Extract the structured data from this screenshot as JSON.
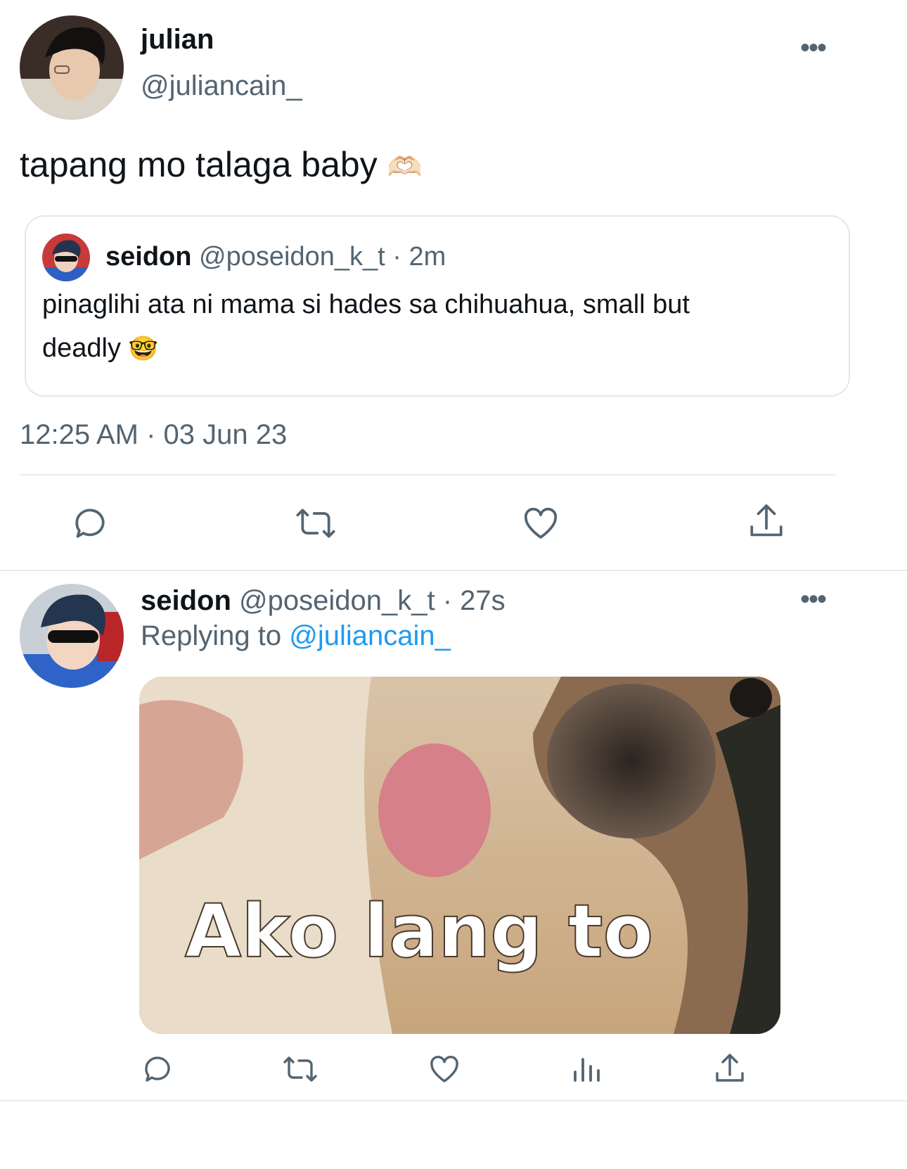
{
  "main_tweet": {
    "author_name": "julian",
    "author_handle": "@juliancain_",
    "text": "tapang mo talaga baby",
    "emoji": "🫶🏻",
    "timestamp": "12:25 AM · 03 Jun 23",
    "quoted": {
      "author_name": "seidon",
      "author_handle": "@poseidon_k_t",
      "age": "· 2m",
      "text_line1": "pinaglihi ata ni mama si hades sa chihuahua, small but",
      "text_line2": "deadly",
      "emoji": "🤓"
    },
    "actions": [
      "reply-icon",
      "retweet-icon",
      "like-icon",
      "share-icon"
    ]
  },
  "reply_tweet": {
    "author_name": "seidon",
    "author_handle": "@poseidon_k_t",
    "age": "· 27s",
    "replying_prefix": "Replying to",
    "replying_handle": "@juliancain_",
    "image_caption": "Ako lang to",
    "actions": [
      "reply-icon",
      "retweet-icon",
      "like-icon",
      "views-icon",
      "share-icon"
    ]
  },
  "colors": {
    "text": "#0f1419",
    "secondary": "#536471",
    "link": "#1d9bf0",
    "divider": "#e6ecf0"
  }
}
